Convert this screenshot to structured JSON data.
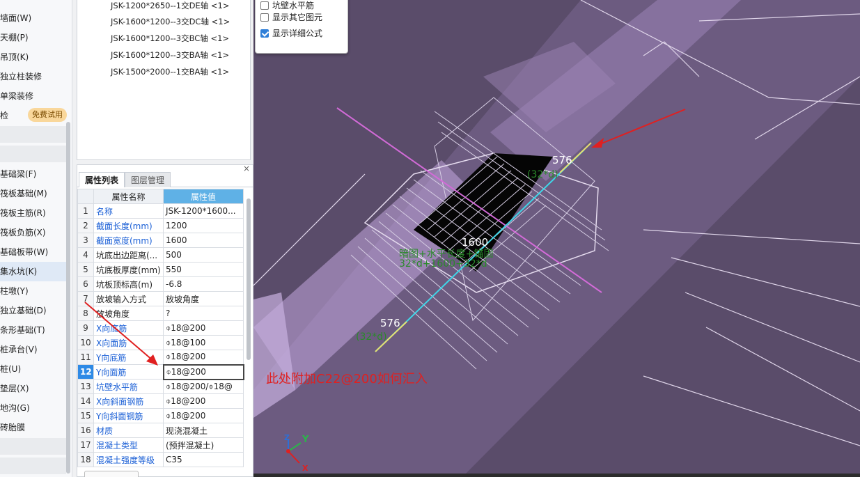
{
  "nav": {
    "items": [
      "墙面(W)",
      "天棚(P)",
      "吊顶(K)",
      "独立柱装修",
      "单梁装修",
      "检",
      "",
      "",
      "基础梁(F)",
      "筏板基础(M)",
      "筏板主筋(R)",
      "筏板负筋(X)",
      "基础板带(W)",
      "集水坑(K)",
      "柱墩(Y)",
      "独立基础(D)",
      "条形基础(T)",
      "桩承台(V)",
      "桩(U)",
      "垫层(X)",
      "地沟(G)",
      "砖胎膜"
    ],
    "trial_badge": "免费试用"
  },
  "tree": {
    "items": [
      "JSK-1200*2650--1交DE轴 <1>",
      "JSK-1600*1200--3交DC轴 <1>",
      "JSK-1600*1200--3交BC轴 <1>",
      "JSK-1600*1200--3交BA轴 <1>",
      "JSK-1500*2000--1交BA轴 <1>"
    ]
  },
  "properties": {
    "close": "×",
    "tab_active": "属性列表",
    "tab_inactive": "图层管理",
    "header_name": "属性名称",
    "header_value": "属性值",
    "rows": [
      {
        "n": "1",
        "name": "名称",
        "value": "JSK-1200*1600...",
        "blue": true
      },
      {
        "n": "2",
        "name": "截面长度(mm)",
        "value": "1200",
        "blue": true
      },
      {
        "n": "3",
        "name": "截面宽度(mm)",
        "value": "1600",
        "blue": true
      },
      {
        "n": "4",
        "name": "坑底出边距离(...",
        "value": "500",
        "blue": false
      },
      {
        "n": "5",
        "name": "坑底板厚度(mm)",
        "value": "550",
        "blue": false
      },
      {
        "n": "6",
        "name": "坑板顶标高(m)",
        "value": "-6.8",
        "blue": false
      },
      {
        "n": "7",
        "name": "放坡输入方式",
        "value": "放坡角度",
        "blue": false
      },
      {
        "n": "8",
        "name": "放坡角度",
        "value": "?",
        "blue": false
      },
      {
        "n": "9",
        "name": "X向底筋",
        "value": "⌽18@200",
        "blue": true
      },
      {
        "n": "10",
        "name": "X向面筋",
        "value": "⌽18@100",
        "blue": true
      },
      {
        "n": "11",
        "name": "Y向底筋",
        "value": "⌽18@200",
        "blue": true
      },
      {
        "n": "12",
        "name": "Y向面筋",
        "value": "⌽18@200",
        "blue": true
      },
      {
        "n": "13",
        "name": "坑壁水平筋",
        "value": "⌽18@200/⌽18@",
        "blue": true
      },
      {
        "n": "14",
        "name": "X向斜面钢筋",
        "value": "⌽18@200",
        "blue": true
      },
      {
        "n": "15",
        "name": "Y向斜面钢筋",
        "value": "⌽18@200",
        "blue": true
      },
      {
        "n": "16",
        "name": "材质",
        "value": "现浇混凝土",
        "blue": true
      },
      {
        "n": "17",
        "name": "混凝土类型",
        "value": "(预拌混凝土)",
        "blue": true
      },
      {
        "n": "18",
        "name": "混凝土强度等级",
        "value": "C35",
        "blue": true
      }
    ],
    "selected_row": "12"
  },
  "display_options": {
    "items": [
      {
        "label": "坑壁水平筋",
        "checked": false
      },
      {
        "label": "显示其它图元",
        "checked": false
      },
      {
        "label": "显示详细公式",
        "checked": true
      }
    ]
  },
  "annotations": {
    "dim_top": "576",
    "dim_top_formula": "(32*d)",
    "dim_mid": "1600",
    "dim_mid_formula_1": "暗图+水平长度+锚固",
    "dim_mid_formula_2": "32*d+1600+32*d",
    "dim_bottom": "576",
    "dim_bottom_formula": "(32*d)",
    "note": "此处附加C22@200如何汇入"
  },
  "axis": {
    "x": "X",
    "y": "Y",
    "z": "Z"
  },
  "colors": {
    "viewport_bg": "#5a4c6a",
    "highlight_blue": "#5fb1e6",
    "note_red": "#e02020",
    "formula_green": "#2a8a2a"
  }
}
